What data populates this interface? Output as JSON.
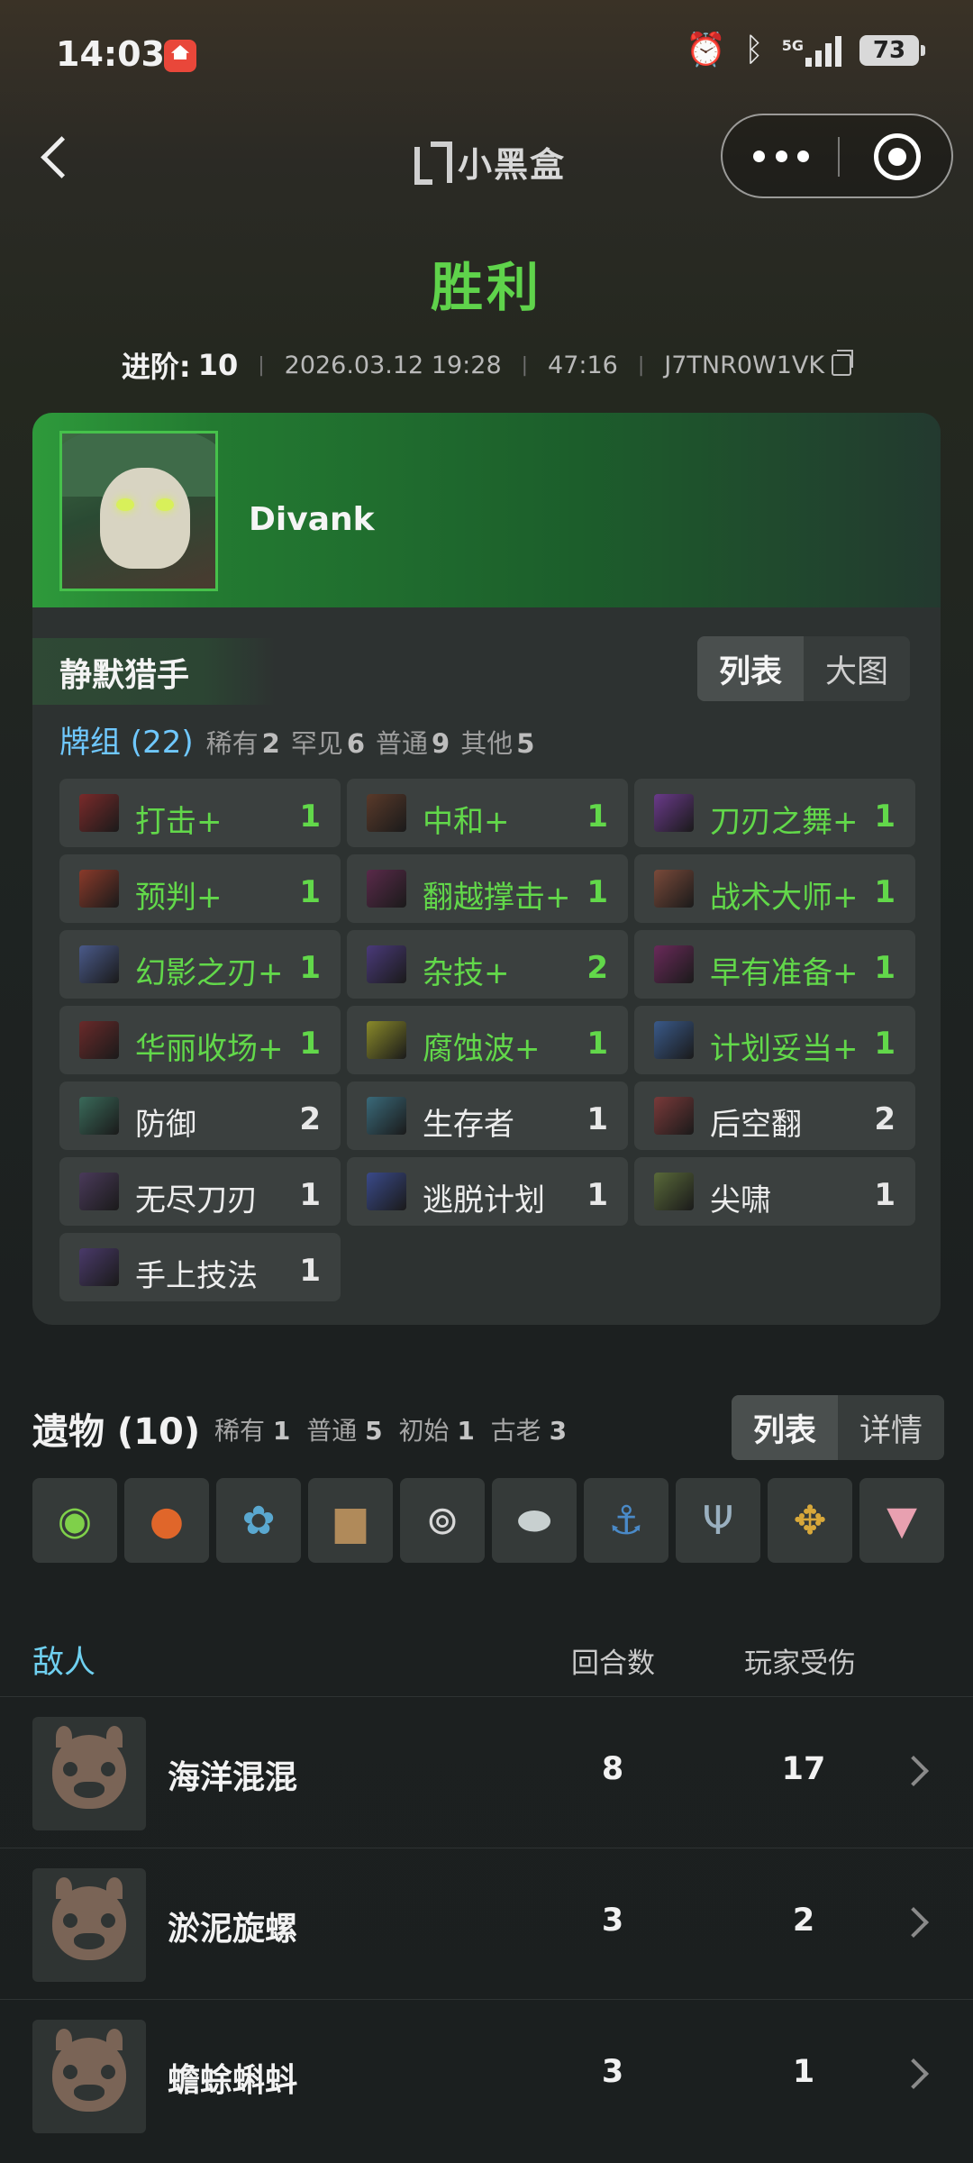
{
  "status_bar": {
    "time": "14:03",
    "network": "5G",
    "battery": "73",
    "icons": [
      "app-home-icon",
      "alarm-icon",
      "bluetooth-icon",
      "signal-icon",
      "battery-icon"
    ]
  },
  "nav": {
    "logo_text": "小黑盒",
    "icons": [
      "back-icon",
      "more-icon",
      "close-miniapp-icon"
    ]
  },
  "result": "胜利",
  "meta": {
    "ascension_label": "进阶:",
    "ascension_value": "10",
    "datetime": "2026.03.12 19:28",
    "duration": "47:16",
    "seed": "J7TNR0W1VK"
  },
  "player": {
    "name": "Divank",
    "character": "静默猎手",
    "view_tabs": [
      "列表",
      "大图"
    ],
    "active_tab": "列表"
  },
  "deck": {
    "title": "牌组 (22)",
    "rarity": [
      {
        "label": "稀有",
        "count": "2"
      },
      {
        "label": "罕见",
        "count": "6"
      },
      {
        "label": "普通",
        "count": "9"
      },
      {
        "label": "其他",
        "count": "5"
      }
    ],
    "cards": [
      {
        "name": "打击+",
        "count": "1",
        "upgraded": true,
        "art": "#7a2a2a"
      },
      {
        "name": "中和+",
        "count": "1",
        "upgraded": true,
        "art": "#5a3a2a"
      },
      {
        "name": "刀刃之舞+",
        "count": "1",
        "upgraded": true,
        "art": "#6a3a8a"
      },
      {
        "name": "预判+",
        "count": "1",
        "upgraded": true,
        "art": "#8a3a2a"
      },
      {
        "name": "翻越撑击+",
        "count": "1",
        "upgraded": true,
        "art": "#5a2a4a"
      },
      {
        "name": "战术大师+",
        "count": "1",
        "upgraded": true,
        "art": "#7a4a3a"
      },
      {
        "name": "幻影之刃+",
        "count": "1",
        "upgraded": true,
        "art": "#4a5a8a"
      },
      {
        "name": "杂技+",
        "count": "2",
        "upgraded": true,
        "art": "#4a3a7a"
      },
      {
        "name": "早有准备+",
        "count": "1",
        "upgraded": true,
        "art": "#6a2a5a"
      },
      {
        "name": "华丽收场+",
        "count": "1",
        "upgraded": true,
        "art": "#6a2a2a"
      },
      {
        "name": "腐蚀波+",
        "count": "1",
        "upgraded": true,
        "art": "#8a8a2a"
      },
      {
        "name": "计划妥当+",
        "count": "1",
        "upgraded": true,
        "art": "#3a5a8a"
      },
      {
        "name": "防御",
        "count": "2",
        "upgraded": false,
        "art": "#3a6a5a"
      },
      {
        "name": "生存者",
        "count": "1",
        "upgraded": false,
        "art": "#3a6a7a"
      },
      {
        "name": "后空翻",
        "count": "2",
        "upgraded": false,
        "art": "#7a3a3a"
      },
      {
        "name": "无尽刀刃",
        "count": "1",
        "upgraded": false,
        "art": "#4a3a5a"
      },
      {
        "name": "逃脱计划",
        "count": "1",
        "upgraded": false,
        "art": "#3a4a8a"
      },
      {
        "name": "尖啸",
        "count": "1",
        "upgraded": false,
        "art": "#5a6a3a"
      },
      {
        "name": "手上技法",
        "count": "1",
        "upgraded": false,
        "art": "#4a3a6a"
      }
    ]
  },
  "relics": {
    "title": "遗物 (10)",
    "rarity": [
      {
        "label": "稀有",
        "count": "1"
      },
      {
        "label": "普通",
        "count": "5"
      },
      {
        "label": "初始",
        "count": "1"
      },
      {
        "label": "古老",
        "count": "3"
      }
    ],
    "view_tabs": [
      "列表",
      "详情"
    ],
    "active_tab": "列表",
    "items": [
      {
        "icon": "ring-of-snake-icon",
        "glyph": "◉",
        "color": "#7fd04a"
      },
      {
        "icon": "orange-orb-icon",
        "glyph": "●",
        "color": "#e0662a"
      },
      {
        "icon": "bead-bracelet-icon",
        "glyph": "✿",
        "color": "#5aa8d0"
      },
      {
        "icon": "backpack-icon",
        "glyph": "▆",
        "color": "#b08a5a"
      },
      {
        "icon": "compass-icon",
        "glyph": "⊚",
        "color": "#d8d8d8"
      },
      {
        "icon": "stone-icon",
        "glyph": "⬬",
        "color": "#c8d0d0"
      },
      {
        "icon": "anchor-icon",
        "glyph": "⚓",
        "color": "#4a8ac8"
      },
      {
        "icon": "trident-icon",
        "glyph": "Ψ",
        "color": "#9ab0c0"
      },
      {
        "icon": "vajra-icon",
        "glyph": "✥",
        "color": "#d8a83a"
      },
      {
        "icon": "ice-cream-icon",
        "glyph": "▼",
        "color": "#e8a0b0"
      }
    ]
  },
  "enemies": {
    "title": "敌人",
    "col_turns": "回合数",
    "col_damage": "玩家受伤",
    "rows": [
      {
        "name": "海洋混混",
        "turns": "8",
        "damage": "17"
      },
      {
        "name": "淤泥旋螺",
        "turns": "3",
        "damage": "2"
      },
      {
        "name": "蟾蜍蝌蚪",
        "turns": "3",
        "damage": "1"
      }
    ]
  }
}
